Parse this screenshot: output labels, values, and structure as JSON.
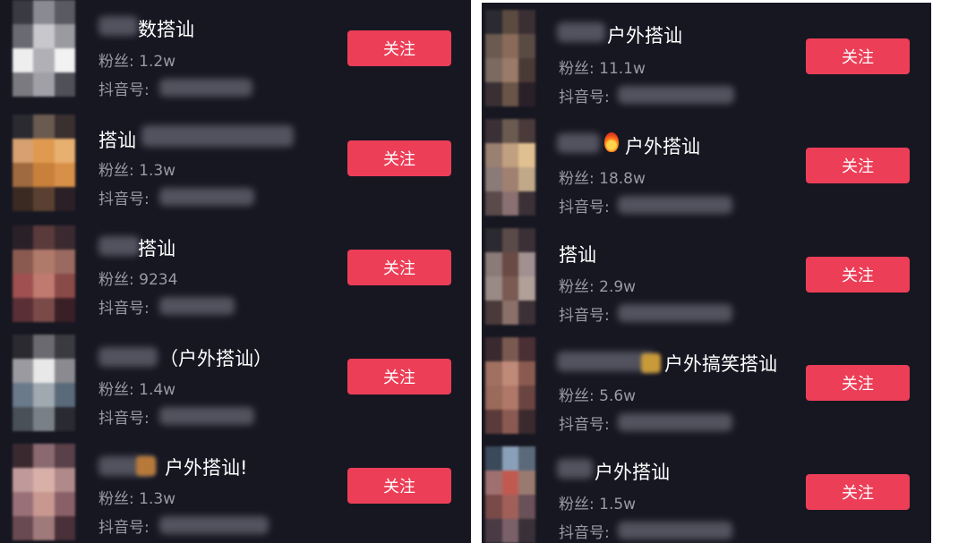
{
  "left": [
    {
      "name": "数搭讪",
      "fans": "粉丝: 1.2w",
      "id": "抖音号:",
      "follow": "关注"
    },
    {
      "name": "搭讪",
      "fans": "粉丝: 1.3w",
      "id": "抖音号:",
      "follow": "关注"
    },
    {
      "name": "搭讪",
      "fans": "粉丝: 9234",
      "id": "抖音号:",
      "follow": "关注"
    },
    {
      "name": "（户外搭讪）",
      "fans": "粉丝: 1.4w",
      "id": "抖音号:",
      "follow": "关注"
    },
    {
      "name": "户外搭讪!",
      "fans": "粉丝: 1.3w",
      "id": "抖音号:",
      "follow": "关注"
    }
  ],
  "right": [
    {
      "name": "户外搭讪",
      "fans": "粉丝: 11.1w",
      "id": "抖音号:",
      "follow": "关注"
    },
    {
      "name": "户外搭讪",
      "fans": "粉丝: 18.8w",
      "id": "抖音号:",
      "follow": "关注"
    },
    {
      "name": "搭讪",
      "fans": "粉丝: 2.9w",
      "id": "抖音号:",
      "follow": "关注"
    },
    {
      "name": "户外搞笑搭讪",
      "fans": "粉丝: 5.6w",
      "id": "抖音号:",
      "follow": "关注"
    },
    {
      "name": "户外搭讪",
      "fans": "粉丝: 1.5w",
      "id": "抖音号:",
      "follow": "关注"
    }
  ],
  "colors": {
    "background": "#171722",
    "follow_button": "#ec3e57",
    "text_primary": "#ffffff",
    "text_secondary": "#9a9aa6"
  }
}
